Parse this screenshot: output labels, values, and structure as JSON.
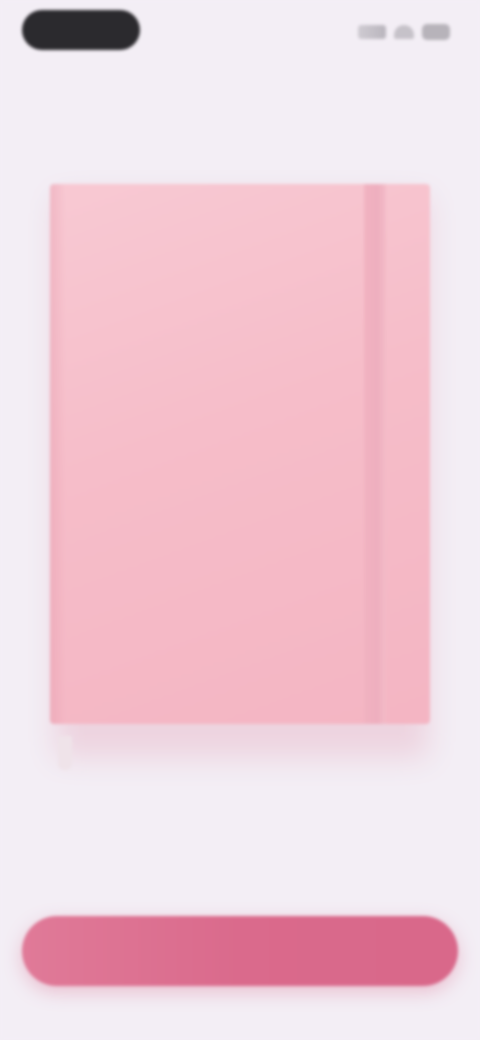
{
  "status_bar": {
    "time": "",
    "icons": [
      "signal-icon",
      "wifi-icon",
      "battery-icon"
    ]
  },
  "journal": {
    "title_line_1": "",
    "title_line_2": "",
    "cover_color": "#f6bdc9",
    "band_color": "#eeaebe"
  },
  "caption": "",
  "primary_button": {
    "label": "",
    "color": "#da6a8c"
  },
  "background_color": "#f3eef5"
}
